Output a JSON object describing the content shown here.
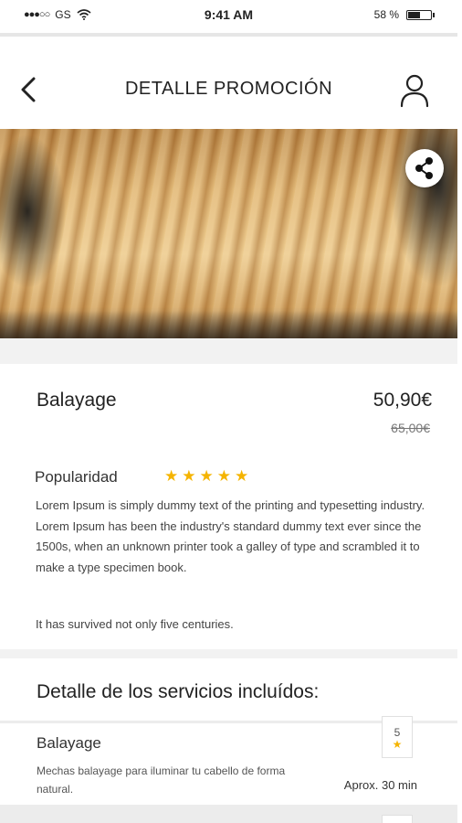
{
  "status_bar": {
    "signal": "●●●○○",
    "carrier": "GS",
    "time": "9:41 AM",
    "battery": "58 %",
    "battery_level": 0.58
  },
  "header": {
    "title": "DETALLE PROMOCIÓN"
  },
  "promotion": {
    "name": "Balayage",
    "price": "50,90€",
    "old_price": "65,00€",
    "popularity_label": "Popularidad",
    "rating_stars": "★★★★★",
    "rating": 5,
    "description": "Lorem Ipsum is simply dummy text of the printing and typesetting industry. Lorem Ipsum has been the industry's standard dummy text ever since the 1500s, when an unknown printer took a galley of type and scrambled it to make a type specimen book.",
    "description_extra": "It has survived not only five centuries."
  },
  "services": {
    "heading": "Detalle de los servicios incluídos:",
    "items": [
      {
        "title": "Balayage",
        "description": "Mechas balayage para iluminar tu cabello de forma natural.",
        "duration": "Aprox. 30 min",
        "rating": "5",
        "star": "★"
      }
    ]
  },
  "icons": {
    "back": "chevron-left-icon",
    "user": "user-icon",
    "share": "share-icon",
    "wifi": "wifi-icon",
    "battery": "battery-icon"
  },
  "colors": {
    "star": "#f5b400",
    "text": "#222222",
    "separator": "#f2f2f2"
  }
}
